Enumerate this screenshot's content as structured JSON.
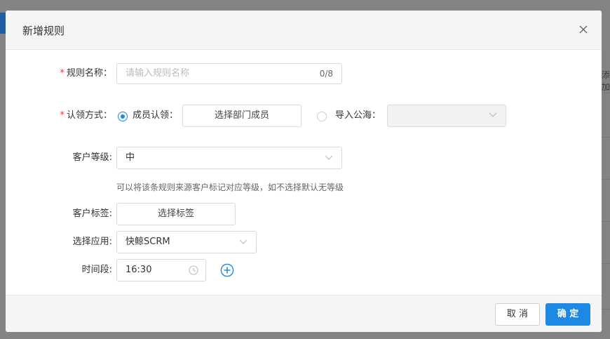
{
  "background": {
    "right_edge_text": "添加"
  },
  "modal": {
    "title": "新增规则",
    "close_icon": "close-icon"
  },
  "form": {
    "rule_name": {
      "required_mark": "*",
      "label": "规则名称：",
      "placeholder": "请输入规则名称",
      "value": "",
      "count": "0/8"
    },
    "claim_method": {
      "required_mark": "*",
      "label": "认领方式：",
      "option_member_label": "成员认领：",
      "option_member_checked": true,
      "member_button": "选择部门成员",
      "option_sea_label": "导入公海：",
      "option_sea_checked": false,
      "sea_select_value": ""
    },
    "customer_level": {
      "label": "客户等级:",
      "value": "中",
      "hint": "可以将该条规则来源客户标记对应等级，如不选择默认无等级"
    },
    "customer_tag": {
      "label": "客户标签:",
      "button": "选择标签"
    },
    "app": {
      "label": "选择应用:",
      "value": "快鲸SCRM"
    },
    "time_period": {
      "label": "时间段:",
      "value": "16:30",
      "clock_icon": "clock-icon",
      "add_icon": "plus-circle-icon"
    }
  },
  "footer": {
    "cancel": "取 消",
    "confirm": "确 定"
  },
  "colors": {
    "primary": "#1e88e5",
    "required": "#e4393c",
    "overlay": "#838383"
  }
}
